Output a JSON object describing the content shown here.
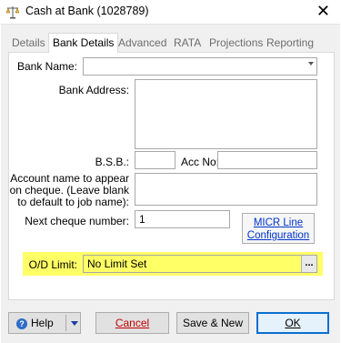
{
  "window": {
    "title": "Cash at Bank (1028789)",
    "close_glyph": "✕"
  },
  "tabs": [
    {
      "label": "Details",
      "active": false
    },
    {
      "label": "Bank Details",
      "active": true
    },
    {
      "label": "Advanced",
      "active": false
    },
    {
      "label": "RATA",
      "active": false
    },
    {
      "label": "Projections",
      "active": false
    },
    {
      "label": "Reporting",
      "active": false
    }
  ],
  "form": {
    "bank_name_label": "Bank Name:",
    "bank_name_value": "",
    "bank_address_label": "Bank Address:",
    "bank_address_value": "",
    "bsb_label": "B.S.B.:",
    "bsb_value": "",
    "acc_no_label": "Acc No:",
    "acc_no_value": "",
    "account_name_label_1": "Account name to appear",
    "account_name_label_2": "on cheque.  (Leave blank",
    "account_name_label_3": "to default to job name):",
    "account_name_value": "",
    "next_cheque_label": "Next cheque number:",
    "next_cheque_value": "1",
    "micr_line_1": "MICR Line",
    "micr_line_2": "Configuration",
    "od_limit_label": "O/D Limit:",
    "od_limit_value": "No Limit Set",
    "od_ellipsis": "..."
  },
  "buttons": {
    "help": "Help",
    "cancel": "Cancel",
    "save_new": "Save & New",
    "ok": "OK"
  },
  "colors": {
    "highlight": "#ffff66",
    "link": "#0033cc",
    "default_border": "#0a6fcf"
  }
}
